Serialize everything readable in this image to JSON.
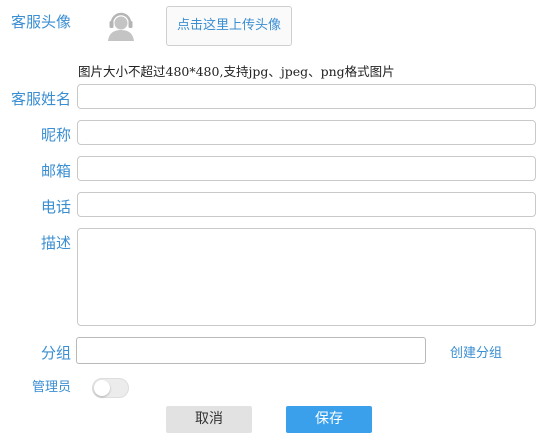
{
  "avatar": {
    "label": "客服头像",
    "upload_button": "点击这里上传头像",
    "hint": "图片大小不超过480*480,支持jpg、jpeg、png格式图片",
    "icon": "user-avatar-icon"
  },
  "fields": {
    "name": {
      "label": "客服姓名",
      "value": ""
    },
    "nickname": {
      "label": "昵称",
      "value": ""
    },
    "email": {
      "label": "邮箱",
      "value": ""
    },
    "phone": {
      "label": "电话",
      "value": ""
    },
    "description": {
      "label": "描述",
      "value": ""
    },
    "group": {
      "label": "分组",
      "value": "",
      "create_link": "创建分组"
    }
  },
  "admin": {
    "label": "管理员",
    "enabled": false
  },
  "actions": {
    "cancel": "取消",
    "save": "保存"
  },
  "colors": {
    "accent": "#3a8ed2",
    "primary_button": "#3aa0ec",
    "cancel_button": "#e2e2e2"
  }
}
